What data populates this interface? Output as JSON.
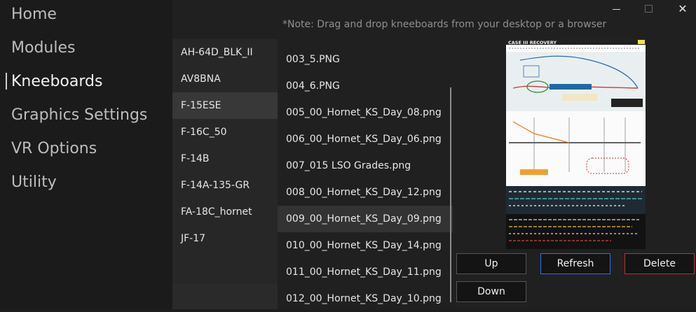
{
  "nav": {
    "items": [
      {
        "label": "Home"
      },
      {
        "label": "Modules"
      },
      {
        "label": "Kneeboards"
      },
      {
        "label": "Graphics Settings"
      },
      {
        "label": "VR Options"
      },
      {
        "label": "Utility"
      }
    ],
    "active": "Kneeboards"
  },
  "note": "*Note: Drag and drop kneeboards from your desktop or a browser",
  "modules": {
    "items": [
      {
        "label": "AH-64D_BLK_II"
      },
      {
        "label": "AV8BNA"
      },
      {
        "label": "F-15ESE"
      },
      {
        "label": "F-16C_50"
      },
      {
        "label": "F-14B"
      },
      {
        "label": "F-14A-135-GR"
      },
      {
        "label": "FA-18C_hornet"
      },
      {
        "label": "JF-17"
      }
    ],
    "selected": "F-15ESE"
  },
  "files": {
    "items": [
      {
        "label": "003_5.PNG"
      },
      {
        "label": "004_6.PNG"
      },
      {
        "label": "005_00_Hornet_KS_Day_08.png"
      },
      {
        "label": "006_00_Hornet_KS_Day_06.png"
      },
      {
        "label": "007_015 LSO Grades.png"
      },
      {
        "label": "008_00_Hornet_KS_Day_12.png"
      },
      {
        "label": "009_00_Hornet_KS_Day_09.png"
      },
      {
        "label": "010_00_Hornet_KS_Day_14.png"
      },
      {
        "label": "011_00_Hornet_KS_Day_11.png"
      },
      {
        "label": "012_00_Hornet_KS_Day_10.png"
      }
    ],
    "selected": "009_00_Hornet_KS_Day_09.png"
  },
  "preview": {
    "title": "CASE III RECOVERY"
  },
  "buttons": {
    "up": "Up",
    "refresh": "Refresh",
    "delete": "Delete",
    "down": "Down"
  },
  "window": {
    "close_glyph": "✕"
  },
  "colors": {
    "accent_blue": "#3a6be0",
    "accent_red": "#c0302e",
    "selected_bg": "#383838"
  }
}
